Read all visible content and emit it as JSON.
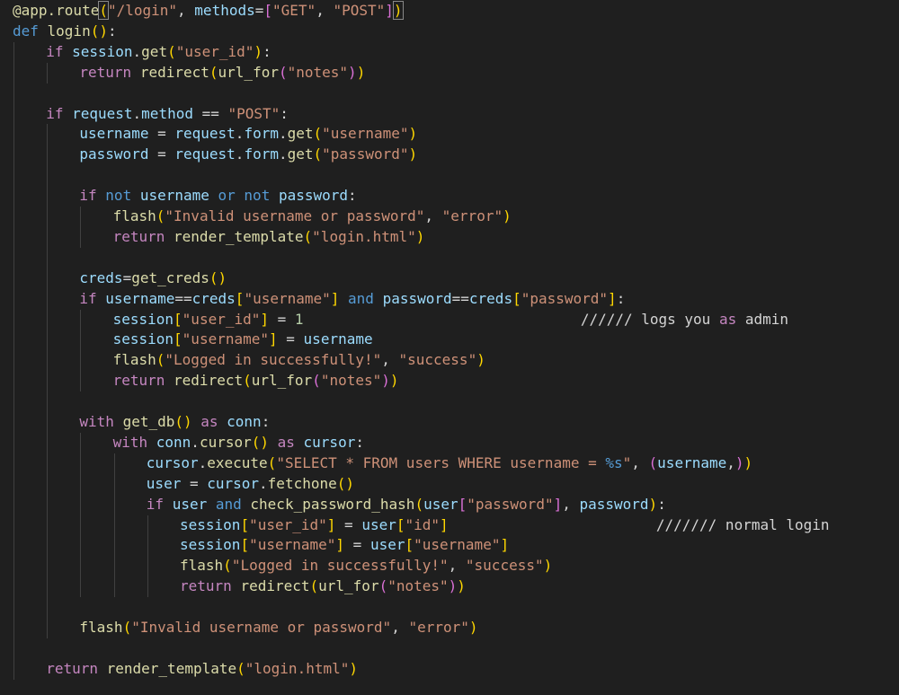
{
  "editor": {
    "lines": [
      {
        "indent": 0,
        "tokens": [
          {
            "t": "@app.route",
            "c": "fn"
          },
          {
            "t": "(",
            "c": "bm"
          },
          {
            "t": "\"/login\"",
            "c": "str"
          },
          {
            "t": ", ",
            "c": "plain"
          },
          {
            "t": "methods",
            "c": "var"
          },
          {
            "t": "=",
            "c": "plain"
          },
          {
            "t": "[",
            "c": "b2"
          },
          {
            "t": "\"GET\"",
            "c": "str"
          },
          {
            "t": ", ",
            "c": "plain"
          },
          {
            "t": "\"POST\"",
            "c": "str"
          },
          {
            "t": "]",
            "c": "b2"
          },
          {
            "t": ")",
            "c": "bm"
          }
        ]
      },
      {
        "indent": 0,
        "tokens": [
          {
            "t": "def ",
            "c": "kw"
          },
          {
            "t": "login",
            "c": "fn"
          },
          {
            "t": "()",
            "c": "b1"
          },
          {
            "t": ":",
            "c": "plain"
          }
        ]
      },
      {
        "indent": 1,
        "tokens": [
          {
            "t": "if ",
            "c": "ctl"
          },
          {
            "t": "session",
            "c": "var"
          },
          {
            "t": ".",
            "c": "plain"
          },
          {
            "t": "get",
            "c": "fn"
          },
          {
            "t": "(",
            "c": "b1"
          },
          {
            "t": "\"user_id\"",
            "c": "str"
          },
          {
            "t": ")",
            "c": "b1"
          },
          {
            "t": ":",
            "c": "plain"
          }
        ]
      },
      {
        "indent": 2,
        "tokens": [
          {
            "t": "return ",
            "c": "ctl"
          },
          {
            "t": "redirect",
            "c": "fn"
          },
          {
            "t": "(",
            "c": "b1"
          },
          {
            "t": "url_for",
            "c": "fn"
          },
          {
            "t": "(",
            "c": "b2"
          },
          {
            "t": "\"notes\"",
            "c": "str"
          },
          {
            "t": ")",
            "c": "b2"
          },
          {
            "t": ")",
            "c": "b1"
          }
        ]
      },
      {
        "indent": 0,
        "tokens": []
      },
      {
        "indent": 1,
        "tokens": [
          {
            "t": "if ",
            "c": "ctl"
          },
          {
            "t": "request",
            "c": "var"
          },
          {
            "t": ".",
            "c": "plain"
          },
          {
            "t": "method",
            "c": "var"
          },
          {
            "t": " == ",
            "c": "plain"
          },
          {
            "t": "\"POST\"",
            "c": "str"
          },
          {
            "t": ":",
            "c": "plain"
          }
        ]
      },
      {
        "indent": 2,
        "tokens": [
          {
            "t": "username",
            "c": "var"
          },
          {
            "t": " = ",
            "c": "plain"
          },
          {
            "t": "request",
            "c": "var"
          },
          {
            "t": ".",
            "c": "plain"
          },
          {
            "t": "form",
            "c": "var"
          },
          {
            "t": ".",
            "c": "plain"
          },
          {
            "t": "get",
            "c": "fn"
          },
          {
            "t": "(",
            "c": "b1"
          },
          {
            "t": "\"username\"",
            "c": "str"
          },
          {
            "t": ")",
            "c": "b1"
          }
        ]
      },
      {
        "indent": 2,
        "tokens": [
          {
            "t": "password",
            "c": "var"
          },
          {
            "t": " = ",
            "c": "plain"
          },
          {
            "t": "request",
            "c": "var"
          },
          {
            "t": ".",
            "c": "plain"
          },
          {
            "t": "form",
            "c": "var"
          },
          {
            "t": ".",
            "c": "plain"
          },
          {
            "t": "get",
            "c": "fn"
          },
          {
            "t": "(",
            "c": "b1"
          },
          {
            "t": "\"password\"",
            "c": "str"
          },
          {
            "t": ")",
            "c": "b1"
          }
        ]
      },
      {
        "indent": 0,
        "tokens": []
      },
      {
        "indent": 2,
        "tokens": [
          {
            "t": "if ",
            "c": "ctl"
          },
          {
            "t": "not ",
            "c": "kw"
          },
          {
            "t": "username",
            "c": "var"
          },
          {
            "t": " or ",
            "c": "kw"
          },
          {
            "t": "not ",
            "c": "kw"
          },
          {
            "t": "password",
            "c": "var"
          },
          {
            "t": ":",
            "c": "plain"
          }
        ]
      },
      {
        "indent": 3,
        "tokens": [
          {
            "t": "flash",
            "c": "fn"
          },
          {
            "t": "(",
            "c": "b1"
          },
          {
            "t": "\"Invalid username or password\"",
            "c": "str"
          },
          {
            "t": ", ",
            "c": "plain"
          },
          {
            "t": "\"error\"",
            "c": "str"
          },
          {
            "t": ")",
            "c": "b1"
          }
        ]
      },
      {
        "indent": 3,
        "tokens": [
          {
            "t": "return ",
            "c": "ctl"
          },
          {
            "t": "render_template",
            "c": "fn"
          },
          {
            "t": "(",
            "c": "b1"
          },
          {
            "t": "\"login.html\"",
            "c": "str"
          },
          {
            "t": ")",
            "c": "b1"
          }
        ]
      },
      {
        "indent": 0,
        "tokens": []
      },
      {
        "indent": 2,
        "tokens": [
          {
            "t": "creds",
            "c": "var"
          },
          {
            "t": "=",
            "c": "plain"
          },
          {
            "t": "get_creds",
            "c": "fn"
          },
          {
            "t": "()",
            "c": "b1"
          }
        ]
      },
      {
        "indent": 2,
        "tokens": [
          {
            "t": "if ",
            "c": "ctl"
          },
          {
            "t": "username",
            "c": "var"
          },
          {
            "t": "==",
            "c": "plain"
          },
          {
            "t": "creds",
            "c": "var"
          },
          {
            "t": "[",
            "c": "b1"
          },
          {
            "t": "\"username\"",
            "c": "str"
          },
          {
            "t": "]",
            "c": "b1"
          },
          {
            "t": " and ",
            "c": "kw"
          },
          {
            "t": "password",
            "c": "var"
          },
          {
            "t": "==",
            "c": "plain"
          },
          {
            "t": "creds",
            "c": "var"
          },
          {
            "t": "[",
            "c": "b1"
          },
          {
            "t": "\"password\"",
            "c": "str"
          },
          {
            "t": "]",
            "c": "b1"
          },
          {
            "t": ":",
            "c": "plain"
          }
        ]
      },
      {
        "indent": 3,
        "tokens": [
          {
            "t": "session",
            "c": "var"
          },
          {
            "t": "[",
            "c": "b1"
          },
          {
            "t": "\"user_id\"",
            "c": "str"
          },
          {
            "t": "]",
            "c": "b1"
          },
          {
            "t": " = ",
            "c": "plain"
          },
          {
            "t": "1",
            "c": "num"
          },
          {
            "t": "                                //////",
            "c": "plain"
          },
          {
            "t": " logs you ",
            "c": "plain"
          },
          {
            "t": "as",
            "c": "ctl"
          },
          {
            "t": " admin",
            "c": "plain"
          }
        ]
      },
      {
        "indent": 3,
        "tokens": [
          {
            "t": "session",
            "c": "var"
          },
          {
            "t": "[",
            "c": "b1"
          },
          {
            "t": "\"username\"",
            "c": "str"
          },
          {
            "t": "]",
            "c": "b1"
          },
          {
            "t": " = ",
            "c": "plain"
          },
          {
            "t": "username",
            "c": "var"
          }
        ]
      },
      {
        "indent": 3,
        "tokens": [
          {
            "t": "flash",
            "c": "fn"
          },
          {
            "t": "(",
            "c": "b1"
          },
          {
            "t": "\"Logged in successfully!\"",
            "c": "str"
          },
          {
            "t": ", ",
            "c": "plain"
          },
          {
            "t": "\"success\"",
            "c": "str"
          },
          {
            "t": ")",
            "c": "b1"
          }
        ]
      },
      {
        "indent": 3,
        "tokens": [
          {
            "t": "return ",
            "c": "ctl"
          },
          {
            "t": "redirect",
            "c": "fn"
          },
          {
            "t": "(",
            "c": "b1"
          },
          {
            "t": "url_for",
            "c": "fn"
          },
          {
            "t": "(",
            "c": "b2"
          },
          {
            "t": "\"notes\"",
            "c": "str"
          },
          {
            "t": ")",
            "c": "b2"
          },
          {
            "t": ")",
            "c": "b1"
          }
        ]
      },
      {
        "indent": 0,
        "tokens": []
      },
      {
        "indent": 2,
        "tokens": [
          {
            "t": "with ",
            "c": "ctl"
          },
          {
            "t": "get_db",
            "c": "fn"
          },
          {
            "t": "()",
            "c": "b1"
          },
          {
            "t": " as ",
            "c": "ctl"
          },
          {
            "t": "conn",
            "c": "var"
          },
          {
            "t": ":",
            "c": "plain"
          }
        ]
      },
      {
        "indent": 3,
        "tokens": [
          {
            "t": "with ",
            "c": "ctl"
          },
          {
            "t": "conn",
            "c": "var"
          },
          {
            "t": ".",
            "c": "plain"
          },
          {
            "t": "cursor",
            "c": "fn"
          },
          {
            "t": "()",
            "c": "b1"
          },
          {
            "t": " as ",
            "c": "ctl"
          },
          {
            "t": "cursor",
            "c": "var"
          },
          {
            "t": ":",
            "c": "plain"
          }
        ]
      },
      {
        "indent": 4,
        "tokens": [
          {
            "t": "cursor",
            "c": "var"
          },
          {
            "t": ".",
            "c": "plain"
          },
          {
            "t": "execute",
            "c": "fn"
          },
          {
            "t": "(",
            "c": "b1"
          },
          {
            "t": "\"SELECT * FROM users WHERE username = ",
            "c": "str"
          },
          {
            "t": "%s",
            "c": "kw"
          },
          {
            "t": "\"",
            "c": "str"
          },
          {
            "t": ", ",
            "c": "plain"
          },
          {
            "t": "(",
            "c": "b2"
          },
          {
            "t": "username",
            "c": "var"
          },
          {
            "t": ",",
            "c": "plain"
          },
          {
            "t": ")",
            "c": "b2"
          },
          {
            "t": ")",
            "c": "b1"
          }
        ]
      },
      {
        "indent": 4,
        "tokens": [
          {
            "t": "user",
            "c": "var"
          },
          {
            "t": " = ",
            "c": "plain"
          },
          {
            "t": "cursor",
            "c": "var"
          },
          {
            "t": ".",
            "c": "plain"
          },
          {
            "t": "fetchone",
            "c": "fn"
          },
          {
            "t": "()",
            "c": "b1"
          }
        ]
      },
      {
        "indent": 4,
        "tokens": [
          {
            "t": "if ",
            "c": "ctl"
          },
          {
            "t": "user",
            "c": "var"
          },
          {
            "t": " and ",
            "c": "kw"
          },
          {
            "t": "check_password_hash",
            "c": "fn"
          },
          {
            "t": "(",
            "c": "b1"
          },
          {
            "t": "user",
            "c": "var"
          },
          {
            "t": "[",
            "c": "b2"
          },
          {
            "t": "\"password\"",
            "c": "str"
          },
          {
            "t": "]",
            "c": "b2"
          },
          {
            "t": ", ",
            "c": "plain"
          },
          {
            "t": "password",
            "c": "var"
          },
          {
            "t": ")",
            "c": "b1"
          },
          {
            "t": ":",
            "c": "plain"
          }
        ]
      },
      {
        "indent": 5,
        "tokens": [
          {
            "t": "session",
            "c": "var"
          },
          {
            "t": "[",
            "c": "b1"
          },
          {
            "t": "\"user_id\"",
            "c": "str"
          },
          {
            "t": "]",
            "c": "b1"
          },
          {
            "t": " = ",
            "c": "plain"
          },
          {
            "t": "user",
            "c": "var"
          },
          {
            "t": "[",
            "c": "b1"
          },
          {
            "t": "\"id\"",
            "c": "str"
          },
          {
            "t": "]",
            "c": "b1"
          },
          {
            "t": "                        ///////",
            "c": "plain"
          },
          {
            "t": " normal login",
            "c": "plain"
          }
        ]
      },
      {
        "indent": 5,
        "tokens": [
          {
            "t": "session",
            "c": "var"
          },
          {
            "t": "[",
            "c": "b1"
          },
          {
            "t": "\"username\"",
            "c": "str"
          },
          {
            "t": "]",
            "c": "b1"
          },
          {
            "t": " = ",
            "c": "plain"
          },
          {
            "t": "user",
            "c": "var"
          },
          {
            "t": "[",
            "c": "b1"
          },
          {
            "t": "\"username\"",
            "c": "str"
          },
          {
            "t": "]",
            "c": "b1"
          }
        ]
      },
      {
        "indent": 5,
        "tokens": [
          {
            "t": "flash",
            "c": "fn"
          },
          {
            "t": "(",
            "c": "b1"
          },
          {
            "t": "\"Logged in successfully!\"",
            "c": "str"
          },
          {
            "t": ", ",
            "c": "plain"
          },
          {
            "t": "\"success\"",
            "c": "str"
          },
          {
            "t": ")",
            "c": "b1"
          }
        ]
      },
      {
        "indent": 5,
        "tokens": [
          {
            "t": "return ",
            "c": "ctl"
          },
          {
            "t": "redirect",
            "c": "fn"
          },
          {
            "t": "(",
            "c": "b1"
          },
          {
            "t": "url_for",
            "c": "fn"
          },
          {
            "t": "(",
            "c": "b2"
          },
          {
            "t": "\"notes\"",
            "c": "str"
          },
          {
            "t": ")",
            "c": "b2"
          },
          {
            "t": ")",
            "c": "b1"
          }
        ]
      },
      {
        "indent": 0,
        "tokens": []
      },
      {
        "indent": 2,
        "tokens": [
          {
            "t": "flash",
            "c": "fn"
          },
          {
            "t": "(",
            "c": "b1"
          },
          {
            "t": "\"Invalid username or password\"",
            "c": "str"
          },
          {
            "t": ", ",
            "c": "plain"
          },
          {
            "t": "\"error\"",
            "c": "str"
          },
          {
            "t": ")",
            "c": "b1"
          }
        ]
      },
      {
        "indent": 0,
        "tokens": []
      },
      {
        "indent": 1,
        "tokens": [
          {
            "t": "return ",
            "c": "ctl"
          },
          {
            "t": "render_template",
            "c": "fn"
          },
          {
            "t": "(",
            "c": "b1"
          },
          {
            "t": "\"login.html\"",
            "c": "str"
          },
          {
            "t": ")",
            "c": "b1"
          }
        ]
      }
    ]
  },
  "colors": {
    "background": "#1f1f1f",
    "keyword": "#569cd6",
    "control": "#c586c0",
    "function": "#dcdcaa",
    "string": "#ce9178",
    "variable": "#9cdcfe",
    "number": "#b5cea8",
    "bracket_1": "#ffd700",
    "bracket_2": "#da70d6"
  }
}
